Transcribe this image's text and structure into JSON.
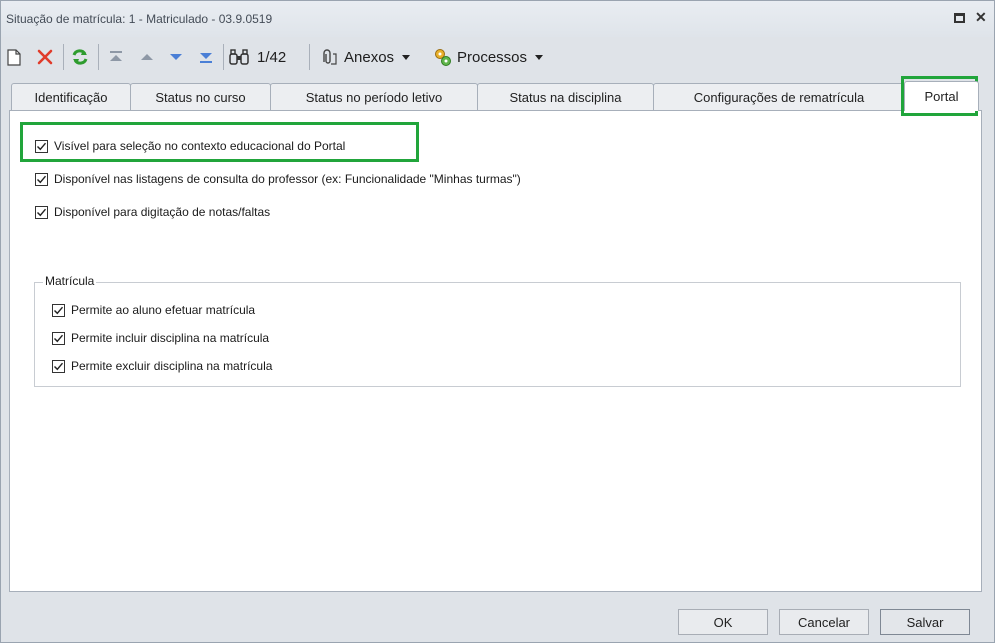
{
  "window": {
    "title": "Situação de matrícula: 1 - Matriculado - 03.9.0519"
  },
  "toolbar": {
    "record_counter": "1/42",
    "attachments_label": "Anexos",
    "processes_label": "Processos"
  },
  "tabs": [
    {
      "label": "Identificação",
      "active": false
    },
    {
      "label": "Status no curso",
      "active": false
    },
    {
      "label": "Status no período letivo",
      "active": false
    },
    {
      "label": "Status na disciplina",
      "active": false
    },
    {
      "label": "Configurações de rematrícula",
      "active": false
    },
    {
      "label": "Portal",
      "active": true
    }
  ],
  "portal": {
    "options": [
      {
        "label": "Visível para seleção no contexto educacional do Portal",
        "checked": true
      },
      {
        "label": "Disponível nas listagens de consulta do professor (ex: Funcionalidade \"Minhas turmas\")",
        "checked": true
      },
      {
        "label": "Disponível para digitação de notas/faltas",
        "checked": true
      }
    ],
    "matricula_group": {
      "legend": "Matrícula",
      "options": [
        {
          "label": "Permite ao aluno efetuar matrícula",
          "checked": true
        },
        {
          "label": "Permite incluir disciplina na matrícula",
          "checked": true
        },
        {
          "label": "Permite excluir disciplina na matrícula",
          "checked": true
        }
      ]
    }
  },
  "buttons": {
    "ok": "OK",
    "cancel": "Cancelar",
    "save": "Salvar"
  },
  "colors": {
    "highlight": "#21a53b",
    "delete_icon": "#e03b2a",
    "refresh_icon": "#2e9c2e",
    "nav_icon": "#4a7fd6"
  }
}
